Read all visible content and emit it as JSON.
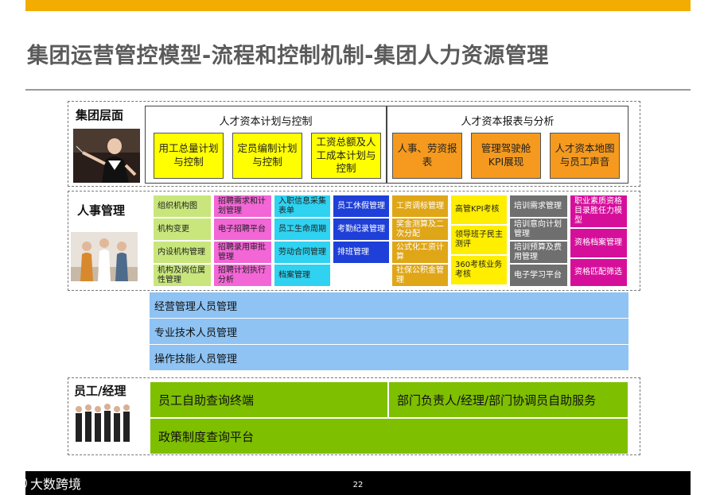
{
  "title": "集团运营管控模型-流程和控制机制-集团人力资源管理",
  "group": {
    "label": "集团层面",
    "plan_panel": {
      "title": "人才资本计划与控制",
      "boxes": [
        "用工总量计划与控制",
        "定员编制计划与控制",
        "工资总额及人工成本计划与控制"
      ]
    },
    "report_panel": {
      "title": "人才资本报表与分析",
      "boxes": [
        "人事、劳资报表",
        "管理驾驶舱KPI展现",
        "人才资本地图与员工声音"
      ]
    }
  },
  "hr": {
    "label": "人事管理",
    "col1": [
      "组织机构图",
      "机构变更",
      "内设机构管理",
      "机构及岗位属性管理"
    ],
    "col2": [
      "招聘需求和计划管理",
      "电子招聘平台",
      "招聘录用审批管理",
      "招聘计划执行分析"
    ],
    "col3": [
      "入职信息采集表单",
      "员工生命周期",
      "劳动合同管理",
      "档案管理"
    ],
    "col4": [
      "员工休假管理",
      "考勤纪录管理",
      "排班管理"
    ],
    "col5": [
      "工资调标管理",
      "奖金测算及二次分配",
      "公式化工资计算",
      "社保公积金管理"
    ],
    "col6": [
      "高管KPI考核",
      "领导班子民主测评",
      "360考核业务考核"
    ],
    "col7": [
      "培训需求管理",
      "培训意向计划管理",
      "培训预算及费用管理",
      "电子学习平台"
    ],
    "col8": [
      "职业素质资格目录胜任力模型",
      "资格档案管理",
      "资格匹配筛选"
    ],
    "bands": [
      "经营管理人员管理",
      "专业技术人员管理",
      "操作技能人员管理"
    ]
  },
  "employee": {
    "label": "员工/经理",
    "self_service": "员工自助查询终端",
    "manager_service": "部门负责人/经理/部门协调员自助服务",
    "policy_platform": "政策制度查询平台"
  },
  "footer": {
    "page_number": "22",
    "watermark": "大数跨境"
  },
  "colors": {
    "accent_bar": "#f2ad00",
    "yellow_box": "#ffff00",
    "orange_box": "#f59a1e",
    "light_blue_band": "#8ec3f4",
    "lime_green": "#7ebf00"
  }
}
